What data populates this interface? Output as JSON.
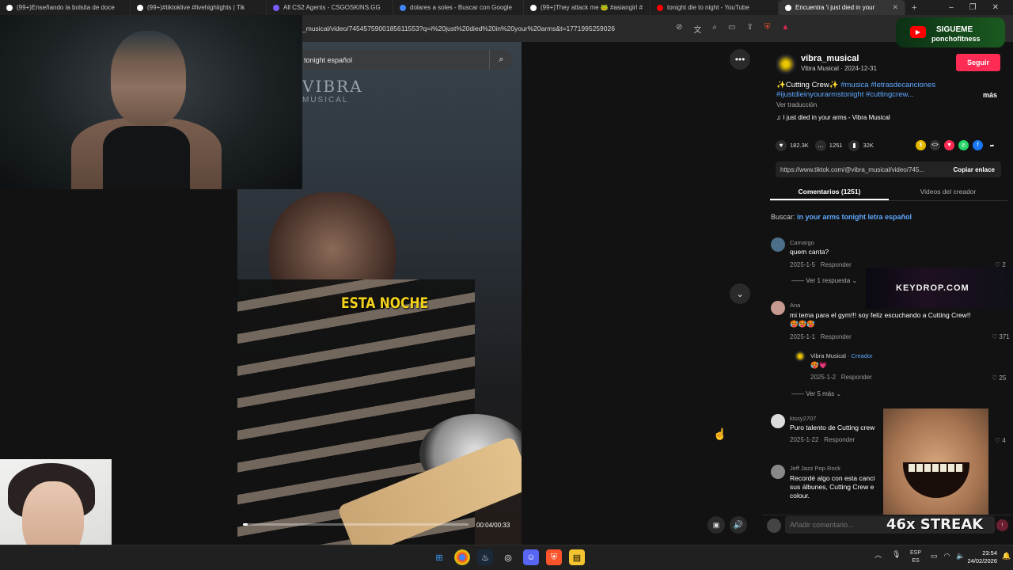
{
  "browser": {
    "tabs": [
      {
        "title": "(99+)Enseñando la bolsita de doce",
        "color": "#ffffff"
      },
      {
        "title": "(99+)#tiktoklive #livehighlights | Tik",
        "color": "#ffffff"
      },
      {
        "title": "All CS2 Agents - CSGOSKINS.GG",
        "color": "#7a5cff"
      },
      {
        "title": "dolares a soles - Buscar con Google",
        "color": "#4285f4"
      },
      {
        "title": "(99+)They attack me 🐸 #asiangirl #",
        "color": "#ffffff"
      },
      {
        "title": "tonight die to night - YouTube",
        "color": "#ff0000"
      },
      {
        "title": "Encuentra 'i just died in your",
        "color": "#ffffff"
      }
    ],
    "url": "_musical/video/7454575900185611553?q=i%20just%20died%20in%20your%20arms&t=1771995259026"
  },
  "video": {
    "search_text": "tonight español",
    "watermark": "VIBRA",
    "watermark_sub": "MUSICAL",
    "lyric": "ESTA NOCHE",
    "time": "00:04/00:33",
    "progress": 0.02
  },
  "panel": {
    "username": "vibra_musical",
    "display_name": "Vibra Musical",
    "date": "2024-12-31",
    "follow_label": "Seguir",
    "desc_plain": "✨Cutting Crew✨",
    "desc_tags": "#musica #letrasdecanciones #ijustdieinyourarmstonight #cuttingcrew...",
    "more_label": "más",
    "translate_label": "Ver traducción",
    "music_label": "♫  I just died in your arms - Vibra Musical",
    "likes": "182.3K",
    "comments": "1251",
    "saves": "32K",
    "link": "https://www.tiktok.com/@vibra_musical/video/745...",
    "copy_label": "Copiar enlace",
    "tab_comments": "Comentarios (1251)",
    "tab_creator": "Videos del creador",
    "buscar_label": "Buscar: ",
    "buscar_query": "in your arms tonight letra español",
    "comment_placeholder": "Añadir comentario..."
  },
  "comments": [
    {
      "name": "Camargo",
      "text": "quem canta?",
      "date": "2025-1-5",
      "reply": "Responder",
      "likes": "2",
      "more": "Ver 1 respuesta"
    },
    {
      "name": "Ana",
      "text": "mi tema para el gym!!! soy feliz escuchando a Cutting Crew!!🥵🥵🥵",
      "date": "2025-1-1",
      "reply": "Responder",
      "likes": "371",
      "more": "Ver 5 más"
    },
    {
      "name": "kissy2707",
      "text": "Puro talento de Cutting crew",
      "date": "2025-1-22",
      "reply": "Responder",
      "likes": "4"
    },
    {
      "name": "Jeff Jazz Pop Rock",
      "text": "Recordé algo con esta canci sus álbunes, Cutting Crew e colour.",
      "date": "",
      "reply": "",
      "likes": ""
    }
  ],
  "reply": {
    "name": "Vibra Musical",
    "badge": "Creador",
    "text": "🥵💗",
    "date": "2025-1-2",
    "reply": "Responder",
    "likes": "25"
  },
  "overlays": {
    "follow_title": "SIGUEME",
    "follow_handle": "ponchofitness",
    "keydrop": "KEYDROP.COM",
    "streak": "46x STREAK"
  },
  "taskbar": {
    "lang_top": "ESP",
    "lang_bottom": "ES",
    "time": "23:54",
    "date": "24/02/2026"
  },
  "colors": {
    "accent": "#fe2c55",
    "link": "#5fa8ff",
    "lyric": "#f3d21c"
  }
}
